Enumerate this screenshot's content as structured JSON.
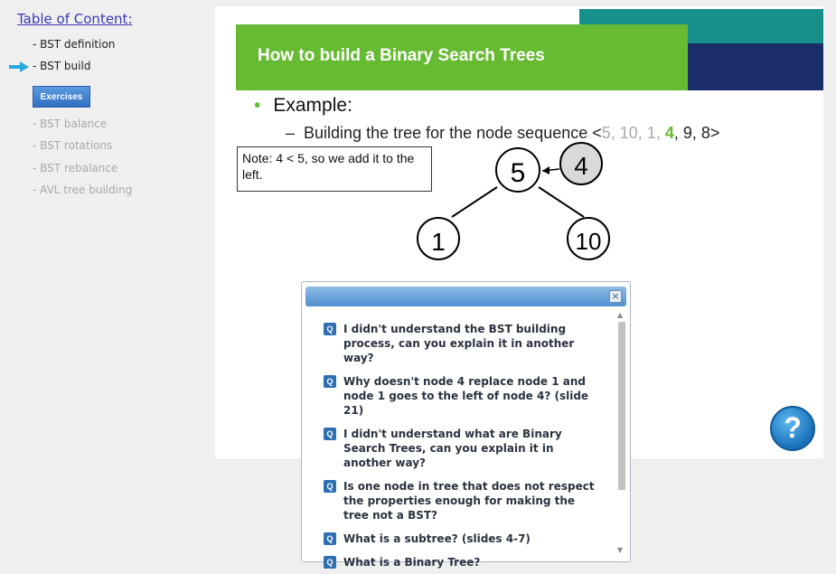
{
  "sidebar": {
    "title": "Table of Content:",
    "items": [
      {
        "label": "- BST definition"
      },
      {
        "label": "- BST build"
      },
      {
        "label": "- BST balance"
      },
      {
        "label": "- BST rotations"
      },
      {
        "label": "- BST rebalance"
      },
      {
        "label": "- AVL tree building"
      }
    ],
    "exercises_label": "Exercises",
    "current_item_icon": "arrow-right-icon"
  },
  "slide": {
    "title": "How to build a Binary Search Trees",
    "bullet": "Example:",
    "subbullet_prefix": "Building the tree for the node sequence <",
    "sequence_before": "5, 10, 1, ",
    "sequence_highlight": "4",
    "sequence_after": ", 9, 8>",
    "note": "Note: 4 < 5, so we add it to the left.",
    "tree_nodes": [
      "5",
      "4",
      "1",
      "10"
    ],
    "colors": {
      "header_green": "#66bb33",
      "teal": "#17908b",
      "navy": "#1c2d6b",
      "new_node_fill": "#d9d9d9"
    }
  },
  "dialog": {
    "close_label": "×",
    "question_badge": "Q",
    "questions": [
      "I didn't understand the BST building process, can you explain it in another way?",
      "Why doesn't node 4 replace node 1 and node 1 goes to the left of node 4? (slide 21)",
      "I didn't understand what are Binary Search Trees, can you explain it in another way?",
      "Is one node in tree that does not respect the properties enough for making the tree not a BST?",
      "What is a subtree? (slides 4-7)",
      "What is a Binary Tree?"
    ]
  },
  "help": {
    "label": "?",
    "icon": "help-icon"
  }
}
